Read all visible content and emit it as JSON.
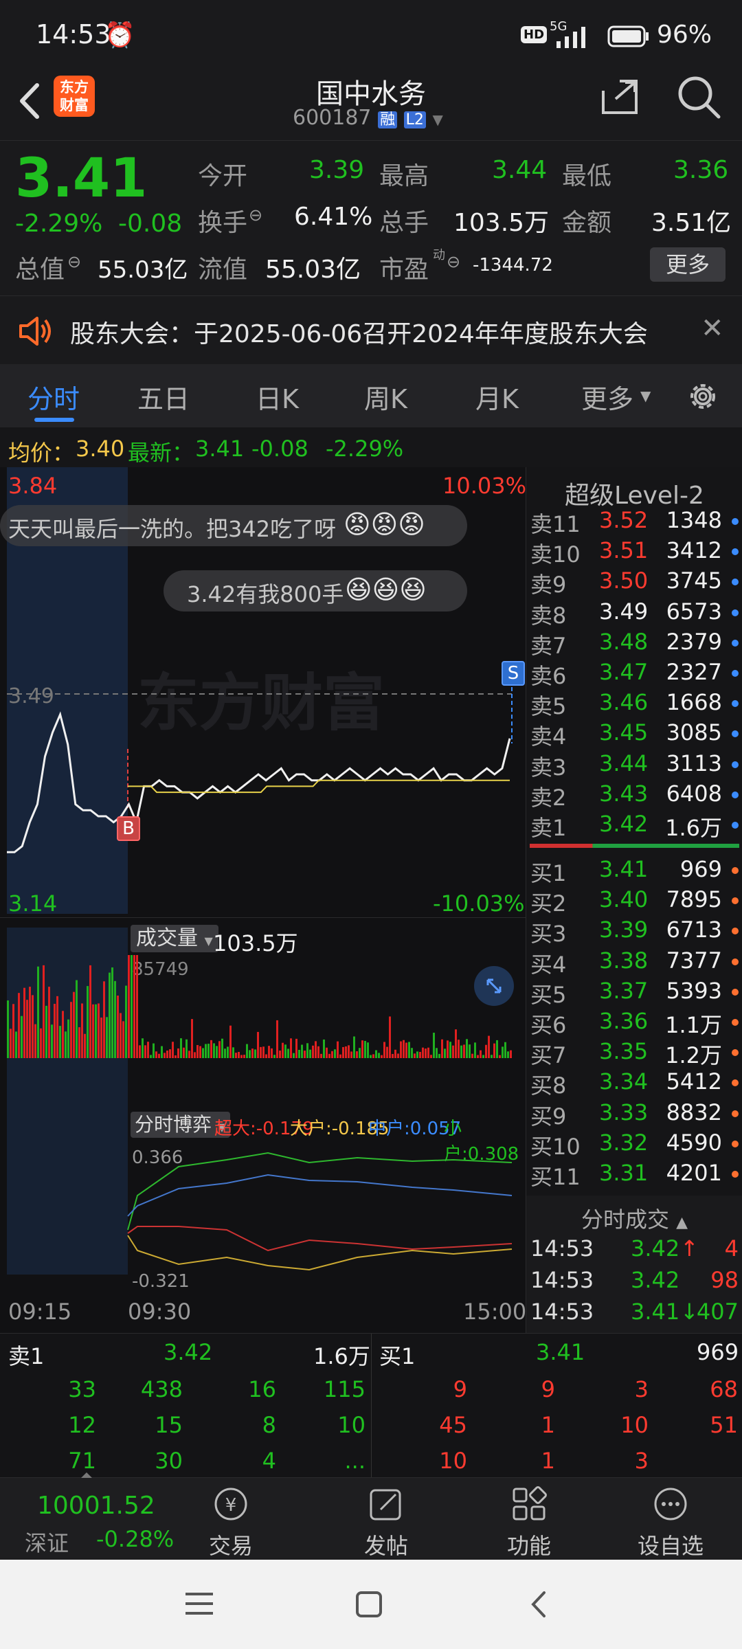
{
  "status_bar": {
    "time": "14:53",
    "network": "5G",
    "hd": "HD",
    "battery": "96%"
  },
  "header": {
    "name": "国中水务",
    "code": "600187",
    "badge_rong": "融",
    "badge_l2": "L2",
    "logo_text": "东方\n财富"
  },
  "quote": {
    "price": "3.41",
    "change_pct": "-2.29%",
    "change": "-0.08",
    "open_label": "今开",
    "open": "3.39",
    "high_label": "最高",
    "high": "3.44",
    "low_label": "最低",
    "low": "3.36",
    "turnover_label": "换手",
    "turnover": "6.41%",
    "volume_label": "总手",
    "volume": "103.5万",
    "amount_label": "金额",
    "amount": "3.51亿",
    "mktcap_label": "总值",
    "mktcap": "55.03亿",
    "float_label": "流值",
    "float": "55.03亿",
    "pe_label": "市盈",
    "pe_sup": "动",
    "pe": "-1344.72",
    "more": "更多"
  },
  "notice": {
    "text": "股东大会：于2025-06-06召开2024年年度股东大会"
  },
  "tabs": [
    "分时",
    "五日",
    "日K",
    "周K",
    "月K",
    "更多"
  ],
  "avg_line": {
    "avg_label": "均价：",
    "avg": "3.40",
    "last_label": "最新：",
    "last": "3.41",
    "chg": "-0.08",
    "chg_pct": "-2.29%"
  },
  "chart": {
    "max_price": "3.84",
    "min_price": "3.14",
    "max_pct": "10.03%",
    "min_pct": "-10.03%",
    "ref_price": "3.49",
    "comment1": "天天叫最后一洗的。把342吃了呀",
    "comment2": "3.42有我800手",
    "marker_b": "B",
    "marker_s": "S",
    "watermark": "东方财富",
    "vol_label": "成交量",
    "vol_total": "103.5万",
    "vol_max": "85749",
    "flow_label": "分时博弈",
    "flow_super": "超大:-0.179",
    "flow_big": "大户:-0.185",
    "flow_mid": "中户:0.057",
    "flow_small": "小户:0.308",
    "flow_top": "0.366",
    "flow_bottom": "-0.321",
    "time_start": "09:15",
    "time_open": "09:30",
    "time_end": "15:00"
  },
  "chart_data": {
    "type": "line",
    "series": [
      {
        "values": [
          3.22,
          3.22,
          3.23,
          3.27,
          3.3,
          3.38,
          3.42,
          3.45,
          3.4,
          3.3,
          3.29,
          3.29,
          3.28,
          3.28,
          3.27,
          3.28,
          3.3,
          3.27,
          3.33,
          3.33,
          3.34,
          3.33,
          3.33,
          3.32,
          3.32,
          3.31,
          3.32,
          3.33,
          3.32,
          3.33,
          3.32,
          3.33,
          3.34,
          3.35,
          3.34,
          3.35,
          3.36,
          3.34,
          3.35,
          3.35,
          3.34,
          3.34,
          3.35,
          3.34,
          3.35,
          3.36,
          3.35,
          3.34,
          3.35,
          3.36,
          3.35,
          3.36,
          3.35,
          3.35,
          3.34,
          3.35,
          3.36,
          3.34,
          3.35,
          3.35,
          3.34,
          3.34,
          3.35,
          3.36,
          3.35,
          3.36,
          3.41
        ]
      },
      {
        "values": [
          3.33,
          3.33,
          3.33,
          3.33,
          3.33,
          3.32,
          3.32,
          3.32,
          3.32,
          3.32,
          3.32,
          3.32,
          3.32,
          3.32,
          3.32,
          3.32,
          3.32,
          3.32,
          3.32,
          3.32,
          3.32,
          3.32,
          3.32,
          3.32,
          3.33,
          3.33,
          3.33,
          3.33,
          3.33,
          3.33,
          3.33,
          3.33,
          3.33,
          3.34,
          3.34,
          3.34,
          3.34,
          3.34,
          3.34,
          3.34,
          3.34,
          3.34,
          3.34,
          3.34,
          3.34,
          3.34,
          3.34,
          3.34,
          3.34,
          3.34,
          3.34,
          3.34,
          3.34,
          3.34,
          3.34,
          3.34,
          3.34,
          3.34,
          3.34,
          3.34,
          3.34,
          3.34,
          3.34,
          3.34,
          3.34,
          3.34,
          3.34
        ]
      }
    ],
    "ylim": [
      3.14,
      3.84
    ]
  },
  "level2": {
    "title": "超级Level-2",
    "sells": [
      {
        "label": "卖11",
        "price": "3.52",
        "vol": "1348",
        "pc": "red"
      },
      {
        "label": "卖10",
        "price": "3.51",
        "vol": "3412",
        "pc": "red"
      },
      {
        "label": "卖9",
        "price": "3.50",
        "vol": "3745",
        "pc": "red"
      },
      {
        "label": "卖8",
        "price": "3.49",
        "vol": "6573",
        "pc": "white"
      },
      {
        "label": "卖7",
        "price": "3.48",
        "vol": "2379",
        "pc": "green"
      },
      {
        "label": "卖6",
        "price": "3.47",
        "vol": "2327",
        "pc": "green"
      },
      {
        "label": "卖5",
        "price": "3.46",
        "vol": "1668",
        "pc": "green"
      },
      {
        "label": "卖4",
        "price": "3.45",
        "vol": "3085",
        "pc": "green"
      },
      {
        "label": "卖3",
        "price": "3.44",
        "vol": "3113",
        "pc": "green"
      },
      {
        "label": "卖2",
        "price": "3.43",
        "vol": "6408",
        "pc": "green"
      },
      {
        "label": "卖1",
        "price": "3.42",
        "vol": "1.6万",
        "pc": "green"
      }
    ],
    "buys": [
      {
        "label": "买1",
        "price": "3.41",
        "vol": "969",
        "pc": "green"
      },
      {
        "label": "买2",
        "price": "3.40",
        "vol": "7895",
        "pc": "green"
      },
      {
        "label": "买3",
        "price": "3.39",
        "vol": "6713",
        "pc": "green"
      },
      {
        "label": "买4",
        "price": "3.38",
        "vol": "7377",
        "pc": "green"
      },
      {
        "label": "买5",
        "price": "3.37",
        "vol": "5393",
        "pc": "green"
      },
      {
        "label": "买6",
        "price": "3.36",
        "vol": "1.1万",
        "pc": "green"
      },
      {
        "label": "买7",
        "price": "3.35",
        "vol": "1.2万",
        "pc": "green"
      },
      {
        "label": "买8",
        "price": "3.34",
        "vol": "5412",
        "pc": "green"
      },
      {
        "label": "买9",
        "price": "3.33",
        "vol": "8832",
        "pc": "green"
      },
      {
        "label": "买10",
        "price": "3.32",
        "vol": "4590",
        "pc": "green"
      },
      {
        "label": "买11",
        "price": "3.31",
        "vol": "4201",
        "pc": "green"
      }
    ],
    "trades_title": "分时成交",
    "trades": [
      {
        "time": "14:53",
        "price": "3.42",
        "arrow": "↑",
        "vol": "4",
        "pc": "green",
        "vc": "red"
      },
      {
        "time": "14:53",
        "price": "3.42",
        "arrow": "",
        "vol": "98",
        "pc": "green",
        "vc": "red"
      },
      {
        "time": "14:53",
        "price": "3.41",
        "arrow": "↓",
        "vol": "407",
        "pc": "green",
        "vc": "green"
      }
    ]
  },
  "orderbook": {
    "sell_label": "卖1",
    "sell_price": "3.42",
    "sell_vol": "1.6万",
    "buy_label": "买1",
    "buy_price": "3.41",
    "buy_vol": "969",
    "sell_rows": [
      [
        "33",
        "438",
        "16",
        "115"
      ],
      [
        "12",
        "15",
        "8",
        "10"
      ],
      [
        "71",
        "30",
        "4",
        "..."
      ]
    ],
    "buy_rows": [
      [
        "9",
        "9",
        "3",
        "68"
      ],
      [
        "45",
        "1",
        "10",
        "51"
      ],
      [
        "10",
        "1",
        "3",
        ""
      ]
    ]
  },
  "bottom_nav": {
    "index_value": "10001.52",
    "index_name": "深证",
    "index_chg": "-0.28%",
    "items": [
      "交易",
      "发帖",
      "功能",
      "设自选"
    ]
  }
}
